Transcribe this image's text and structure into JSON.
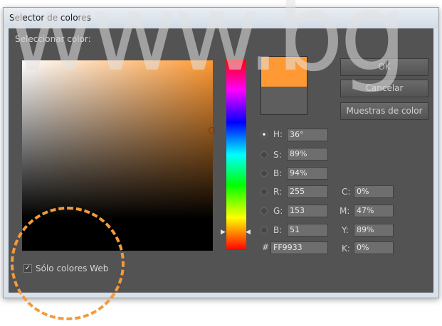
{
  "dialog": {
    "title": "Selector de colores",
    "select_label": "Seleccionar color:"
  },
  "watermark": {
    "text": "www.bg"
  },
  "color": {
    "current_hex": "#ff9933",
    "previous_hex": "#5e5e5e"
  },
  "buttons": {
    "ok": "OK",
    "cancel": "Cancelar",
    "swatches": "Muestras de color"
  },
  "hsb": {
    "H": {
      "label": "H:",
      "value": "36°",
      "selected": true
    },
    "S": {
      "label": "S:",
      "value": "89%",
      "selected": false
    },
    "B": {
      "label": "B:",
      "value": "94%",
      "selected": false
    }
  },
  "rgb": {
    "R": {
      "label": "R:",
      "value": "255",
      "selected": false
    },
    "G": {
      "label": "G:",
      "value": "153",
      "selected": false
    },
    "B": {
      "label": "B:",
      "value": "51",
      "selected": false
    }
  },
  "hex": {
    "label": "#",
    "value": "FF9933"
  },
  "cmyk": {
    "C": {
      "label": "C:",
      "value": "0%"
    },
    "M": {
      "label": "M:",
      "value": "47%"
    },
    "Y": {
      "label": "Y:",
      "value": "89%"
    },
    "K": {
      "label": "K:",
      "value": "0%"
    }
  },
  "web_only": {
    "label": "Sólo colores Web",
    "checked": true,
    "check_glyph": "✓"
  },
  "colors": {
    "dialog_bg": "#535353",
    "highlight": "#f39a3a"
  }
}
